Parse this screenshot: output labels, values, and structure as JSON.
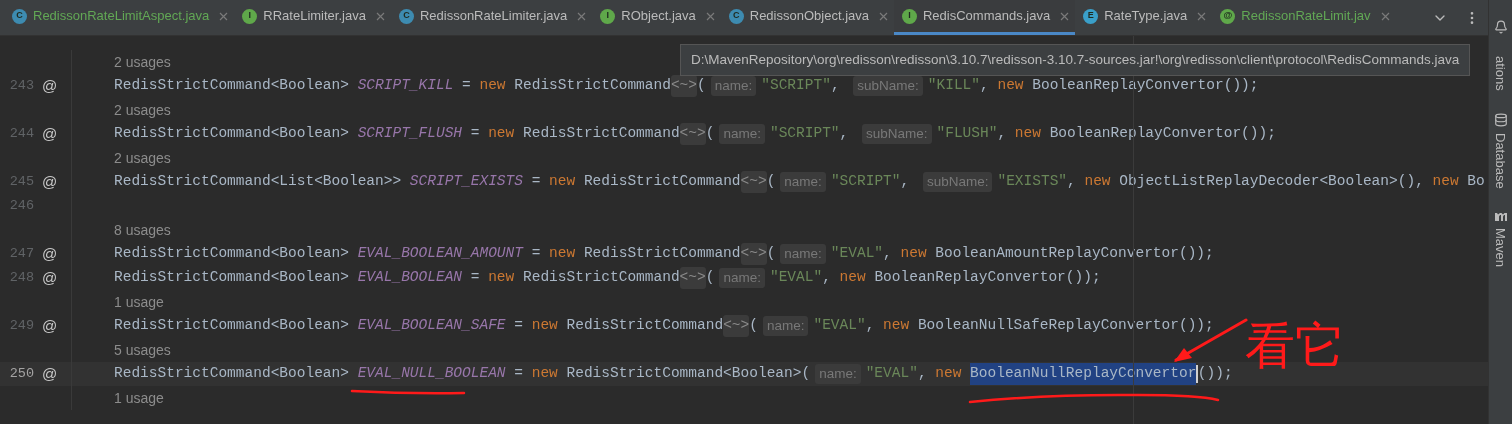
{
  "tabs": [
    {
      "badge": "C",
      "kind": "class",
      "name": "RedissonRateLimitAspect.java",
      "vcs_added": true,
      "selected": false
    },
    {
      "badge": "I",
      "kind": "interface",
      "name": "RRateLimiter.java",
      "vcs_added": false,
      "selected": false
    },
    {
      "badge": "C",
      "kind": "class",
      "name": "RedissonRateLimiter.java",
      "vcs_added": false,
      "selected": false
    },
    {
      "badge": "I",
      "kind": "interface",
      "name": "RObject.java",
      "vcs_added": false,
      "selected": false
    },
    {
      "badge": "C",
      "kind": "class",
      "name": "RedissonObject.java",
      "vcs_added": false,
      "selected": false
    },
    {
      "badge": "I",
      "kind": "interface",
      "name": "RedisCommands.java",
      "vcs_added": false,
      "selected": true
    },
    {
      "badge": "E",
      "kind": "enum",
      "name": "RateType.java",
      "vcs_added": false,
      "selected": false
    },
    {
      "badge": "@",
      "kind": "annotation",
      "name": "RedissonRateLimit.jav",
      "vcs_added": true,
      "selected": false
    }
  ],
  "tooltip": {
    "text": "D:\\MavenRepository\\org\\redisson\\redisson\\3.10.7\\redisson-3.10.7-sources.jar!\\org\\redisson\\client\\protocol\\RedisCommands.java"
  },
  "side_tools": [
    {
      "kind": "notifications",
      "label": "ations"
    },
    {
      "kind": "database",
      "label": "Database"
    },
    {
      "kind": "maven",
      "label": "Maven"
    }
  ],
  "lines": [
    {
      "kind": "usages",
      "text": "2 usages"
    },
    {
      "kind": "code",
      "number": "243",
      "gutter": "@",
      "current": false,
      "tokens": [
        {
          "kind": "plain",
          "t": "RedisStrictCommand<Boolean> "
        },
        {
          "kind": "field",
          "t": "SCRIPT_KILL"
        },
        {
          "kind": "plain",
          "t": " = "
        },
        {
          "kind": "keyword",
          "t": "new"
        },
        {
          "kind": "plain",
          "t": " RedisStrictCommand"
        },
        {
          "kind": "diamond",
          "t": "<~>"
        },
        {
          "kind": "plain",
          "t": "("
        },
        {
          "kind": "hint",
          "t": "name:"
        },
        {
          "kind": "string",
          "t": "\"SCRIPT\""
        },
        {
          "kind": "plain",
          "t": ", "
        },
        {
          "kind": "hint",
          "t": "subName:"
        },
        {
          "kind": "string",
          "t": "\"KILL\""
        },
        {
          "kind": "plain",
          "t": ", "
        },
        {
          "kind": "keyword",
          "t": "new"
        },
        {
          "kind": "plain",
          "t": " BooleanReplayConvertor());"
        }
      ]
    },
    {
      "kind": "usages",
      "text": "2 usages"
    },
    {
      "kind": "code",
      "number": "244",
      "gutter": "@",
      "current": false,
      "tokens": [
        {
          "kind": "plain",
          "t": "RedisStrictCommand<Boolean> "
        },
        {
          "kind": "field",
          "t": "SCRIPT_FLUSH"
        },
        {
          "kind": "plain",
          "t": " = "
        },
        {
          "kind": "keyword",
          "t": "new"
        },
        {
          "kind": "plain",
          "t": " RedisStrictCommand"
        },
        {
          "kind": "diamond",
          "t": "<~>"
        },
        {
          "kind": "plain",
          "t": "("
        },
        {
          "kind": "hint",
          "t": "name:"
        },
        {
          "kind": "string",
          "t": "\"SCRIPT\""
        },
        {
          "kind": "plain",
          "t": ", "
        },
        {
          "kind": "hint",
          "t": "subName:"
        },
        {
          "kind": "string",
          "t": "\"FLUSH\""
        },
        {
          "kind": "plain",
          "t": ", "
        },
        {
          "kind": "keyword",
          "t": "new"
        },
        {
          "kind": "plain",
          "t": " BooleanReplayConvertor());"
        }
      ]
    },
    {
      "kind": "usages",
      "text": "2 usages"
    },
    {
      "kind": "code",
      "number": "245",
      "gutter": "@",
      "current": false,
      "tokens": [
        {
          "kind": "plain",
          "t": "RedisStrictCommand<List<Boolean>> "
        },
        {
          "kind": "field",
          "t": "SCRIPT_EXISTS"
        },
        {
          "kind": "plain",
          "t": " = "
        },
        {
          "kind": "keyword",
          "t": "new"
        },
        {
          "kind": "plain",
          "t": " RedisStrictCommand"
        },
        {
          "kind": "diamond",
          "t": "<~>"
        },
        {
          "kind": "plain",
          "t": "("
        },
        {
          "kind": "hint",
          "t": "name:"
        },
        {
          "kind": "string",
          "t": "\"SCRIPT\""
        },
        {
          "kind": "plain",
          "t": ", "
        },
        {
          "kind": "hint",
          "t": "subName:"
        },
        {
          "kind": "string",
          "t": "\"EXISTS\""
        },
        {
          "kind": "plain",
          "t": ", "
        },
        {
          "kind": "keyword",
          "t": "new"
        },
        {
          "kind": "plain",
          "t": " ObjectListReplayDecoder<Boolean>(), "
        },
        {
          "kind": "keyword",
          "t": "new"
        },
        {
          "kind": "plain",
          "t": " Bo"
        }
      ]
    },
    {
      "kind": "code",
      "number": "246",
      "current": false
    },
    {
      "kind": "usages",
      "text": "8 usages"
    },
    {
      "kind": "code",
      "number": "247",
      "gutter": "@",
      "current": false,
      "tokens": [
        {
          "kind": "plain",
          "t": "RedisStrictCommand<Boolean> "
        },
        {
          "kind": "field",
          "t": "EVAL_BOOLEAN_AMOUNT"
        },
        {
          "kind": "plain",
          "t": " = "
        },
        {
          "kind": "keyword",
          "t": "new"
        },
        {
          "kind": "plain",
          "t": " RedisStrictCommand"
        },
        {
          "kind": "diamond",
          "t": "<~>"
        },
        {
          "kind": "plain",
          "t": "("
        },
        {
          "kind": "hint",
          "t": "name:"
        },
        {
          "kind": "string",
          "t": "\"EVAL\""
        },
        {
          "kind": "plain",
          "t": ", "
        },
        {
          "kind": "keyword",
          "t": "new"
        },
        {
          "kind": "plain",
          "t": " BooleanAmountReplayConvertor());"
        }
      ]
    },
    {
      "kind": "code",
      "number": "248",
      "gutter": "@",
      "current": false,
      "tokens": [
        {
          "kind": "plain",
          "t": "RedisStrictCommand<Boolean> "
        },
        {
          "kind": "field",
          "t": "EVAL_BOOLEAN"
        },
        {
          "kind": "plain",
          "t": " = "
        },
        {
          "kind": "keyword",
          "t": "new"
        },
        {
          "kind": "plain",
          "t": " RedisStrictCommand"
        },
        {
          "kind": "diamond",
          "t": "<~>"
        },
        {
          "kind": "plain",
          "t": "("
        },
        {
          "kind": "hint",
          "t": "name:"
        },
        {
          "kind": "string",
          "t": "\"EVAL\""
        },
        {
          "kind": "plain",
          "t": ", "
        },
        {
          "kind": "keyword",
          "t": "new"
        },
        {
          "kind": "plain",
          "t": " BooleanReplayConvertor());"
        }
      ]
    },
    {
      "kind": "usages",
      "text": "1 usage"
    },
    {
      "kind": "code",
      "number": "249",
      "gutter": "@",
      "current": false,
      "tokens": [
        {
          "kind": "plain",
          "t": "RedisStrictCommand<Boolean> "
        },
        {
          "kind": "field",
          "t": "EVAL_BOOLEAN_SAFE"
        },
        {
          "kind": "plain",
          "t": " = "
        },
        {
          "kind": "keyword",
          "t": "new"
        },
        {
          "kind": "plain",
          "t": " RedisStrictCommand"
        },
        {
          "kind": "diamond",
          "t": "<~>"
        },
        {
          "kind": "plain",
          "t": "("
        },
        {
          "kind": "hint",
          "t": "name:"
        },
        {
          "kind": "string",
          "t": "\"EVAL\""
        },
        {
          "kind": "plain",
          "t": ", "
        },
        {
          "kind": "keyword",
          "t": "new"
        },
        {
          "kind": "plain",
          "t": " BooleanNullSafeReplayConvertor());"
        }
      ]
    },
    {
      "kind": "usages",
      "text": "5 usages"
    },
    {
      "kind": "code",
      "number": "250",
      "gutter": "@",
      "current": true,
      "tokens": [
        {
          "kind": "plain",
          "t": "RedisStrictCommand<Boolean> "
        },
        {
          "kind": "field",
          "t": "EVAL_NULL_BOOLEAN"
        },
        {
          "kind": "plain",
          "t": " = "
        },
        {
          "kind": "keyword",
          "t": "new"
        },
        {
          "kind": "plain",
          "t": " RedisStrictCommand<Boolean>("
        },
        {
          "kind": "hint",
          "t": "name:"
        },
        {
          "kind": "string",
          "t": "\"EVAL\""
        },
        {
          "kind": "plain",
          "t": ", "
        },
        {
          "kind": "keyword",
          "t": "new "
        },
        {
          "kind": "selected",
          "t": "BooleanNullReplayConvertor"
        },
        {
          "kind": "caret"
        },
        {
          "kind": "plain",
          "t": "());"
        }
      ]
    },
    {
      "kind": "usages",
      "text": "1 usage"
    }
  ],
  "annotation": {
    "text": "看它"
  }
}
